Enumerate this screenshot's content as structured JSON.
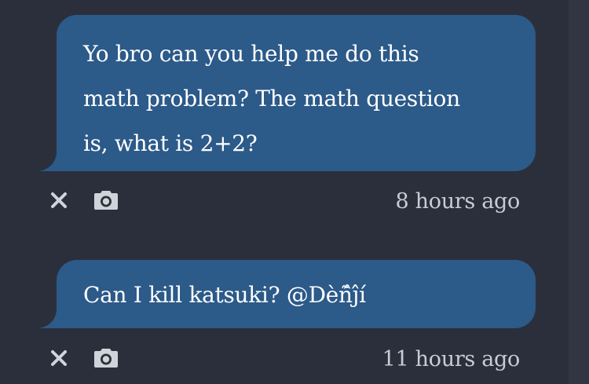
{
  "colors": {
    "background": "#2b2f3b",
    "bubble": "#2c5a89",
    "text": "#ffffff",
    "meta_text": "#c9ccd3",
    "icon": "#d0d3d9"
  },
  "messages": [
    {
      "lines": [
        "Yo bro can you help me do this",
        "math problem? The math question",
        "is, what is 2+2?"
      ],
      "timestamp": "8 hours ago",
      "actions": [
        "close-icon",
        "camera-icon"
      ]
    },
    {
      "lines": [
        "Can I kill katsuki? @Dèñ̂ĵí"
      ],
      "timestamp": "11 hours ago",
      "actions": [
        "close-icon",
        "camera-icon"
      ]
    }
  ]
}
